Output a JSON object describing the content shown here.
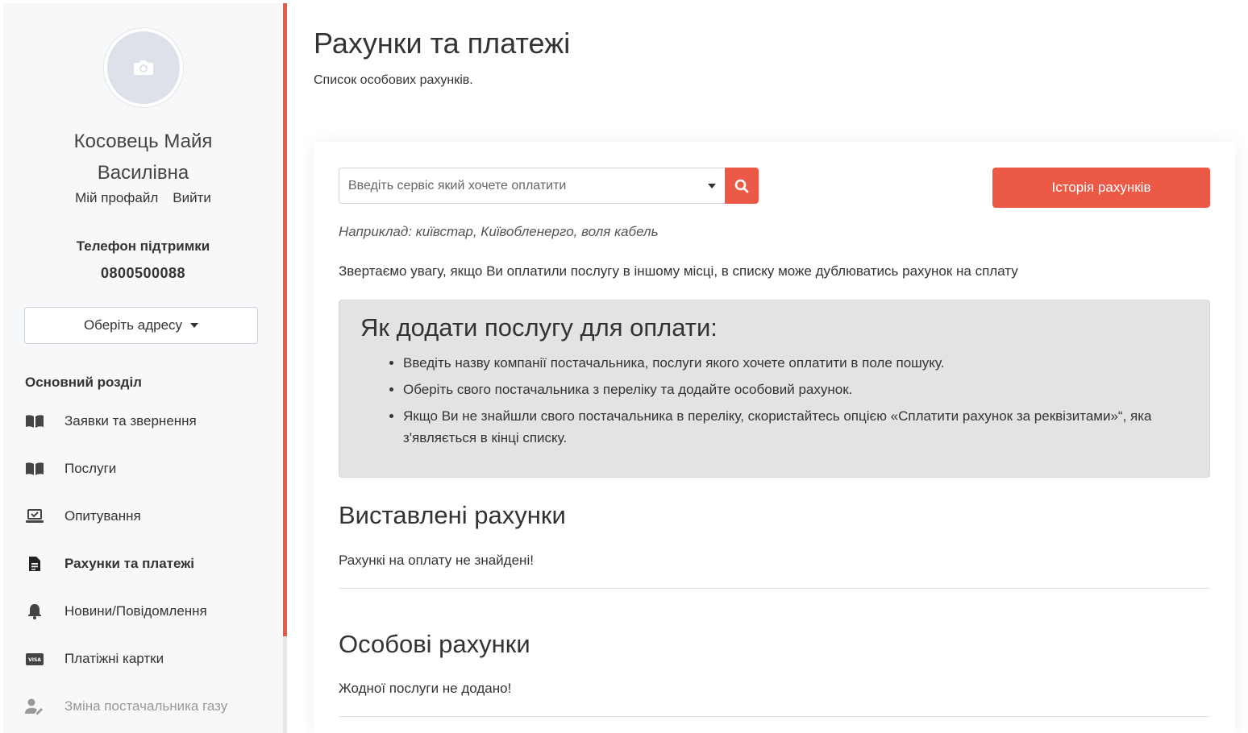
{
  "sidebar": {
    "user_name_line1": "Косовець Майя",
    "user_name_line2": "Василівна",
    "profile_link": "Мій профайл",
    "logout_link": "Вийти",
    "support_label": "Телефон підтримки",
    "support_phone": "0800500088",
    "address_button": "Оберіть адресу",
    "section_label": "Основний розділ",
    "nav": [
      {
        "label": "Заявки та звернення",
        "icon": "book-icon"
      },
      {
        "label": "Послуги",
        "icon": "book-icon"
      },
      {
        "label": "Опитування",
        "icon": "laptop-check-icon"
      },
      {
        "label": "Рахунки та платежі",
        "icon": "file-invoice-icon"
      },
      {
        "label": "Новини/Повідомлення",
        "icon": "bell-icon"
      },
      {
        "label": "Платіжні картки",
        "icon": "visa-card-icon"
      },
      {
        "label": "Зміна постачальника газу",
        "icon": "user-edit-icon"
      }
    ]
  },
  "main": {
    "title": "Рахунки та платежі",
    "subtitle": "Список особових рахунків.",
    "search_placeholder": "Введіть сервіс який хочете оплатити",
    "history_button": "Історія рахунків",
    "example": "Наприклад: київстар, Київобленерго, воля кабель",
    "notice": "Звертаємо увагу, якщо Ви оплатили послугу в іншому місці, в списку може дублюватись рахунок на сплату",
    "howto_title": "Як додати послугу для оплати:",
    "howto_items": [
      "Введіть назву компанії постачальника, послуги якого хочете оплатити в поле пошуку.",
      "Оберіть свого постачальника з переліку та додайте особовий рахунок.",
      "Якщо Ви не знайшли свого постачальника в переліку, скористайтесь опцією «Сплатити рахунок за реквізитами»“, яка з'являється в кінці списку."
    ],
    "issued_title": "Виставлені рахунки",
    "issued_empty": "Рахункі на оплату не знайдені!",
    "personal_title": "Особові рахунки",
    "personal_empty": "Жодної послуги не додано!"
  },
  "colors": {
    "accent": "#ec5a47",
    "sidebar_bg": "#f6f8fa",
    "howto_bg": "#e2e3e5"
  }
}
